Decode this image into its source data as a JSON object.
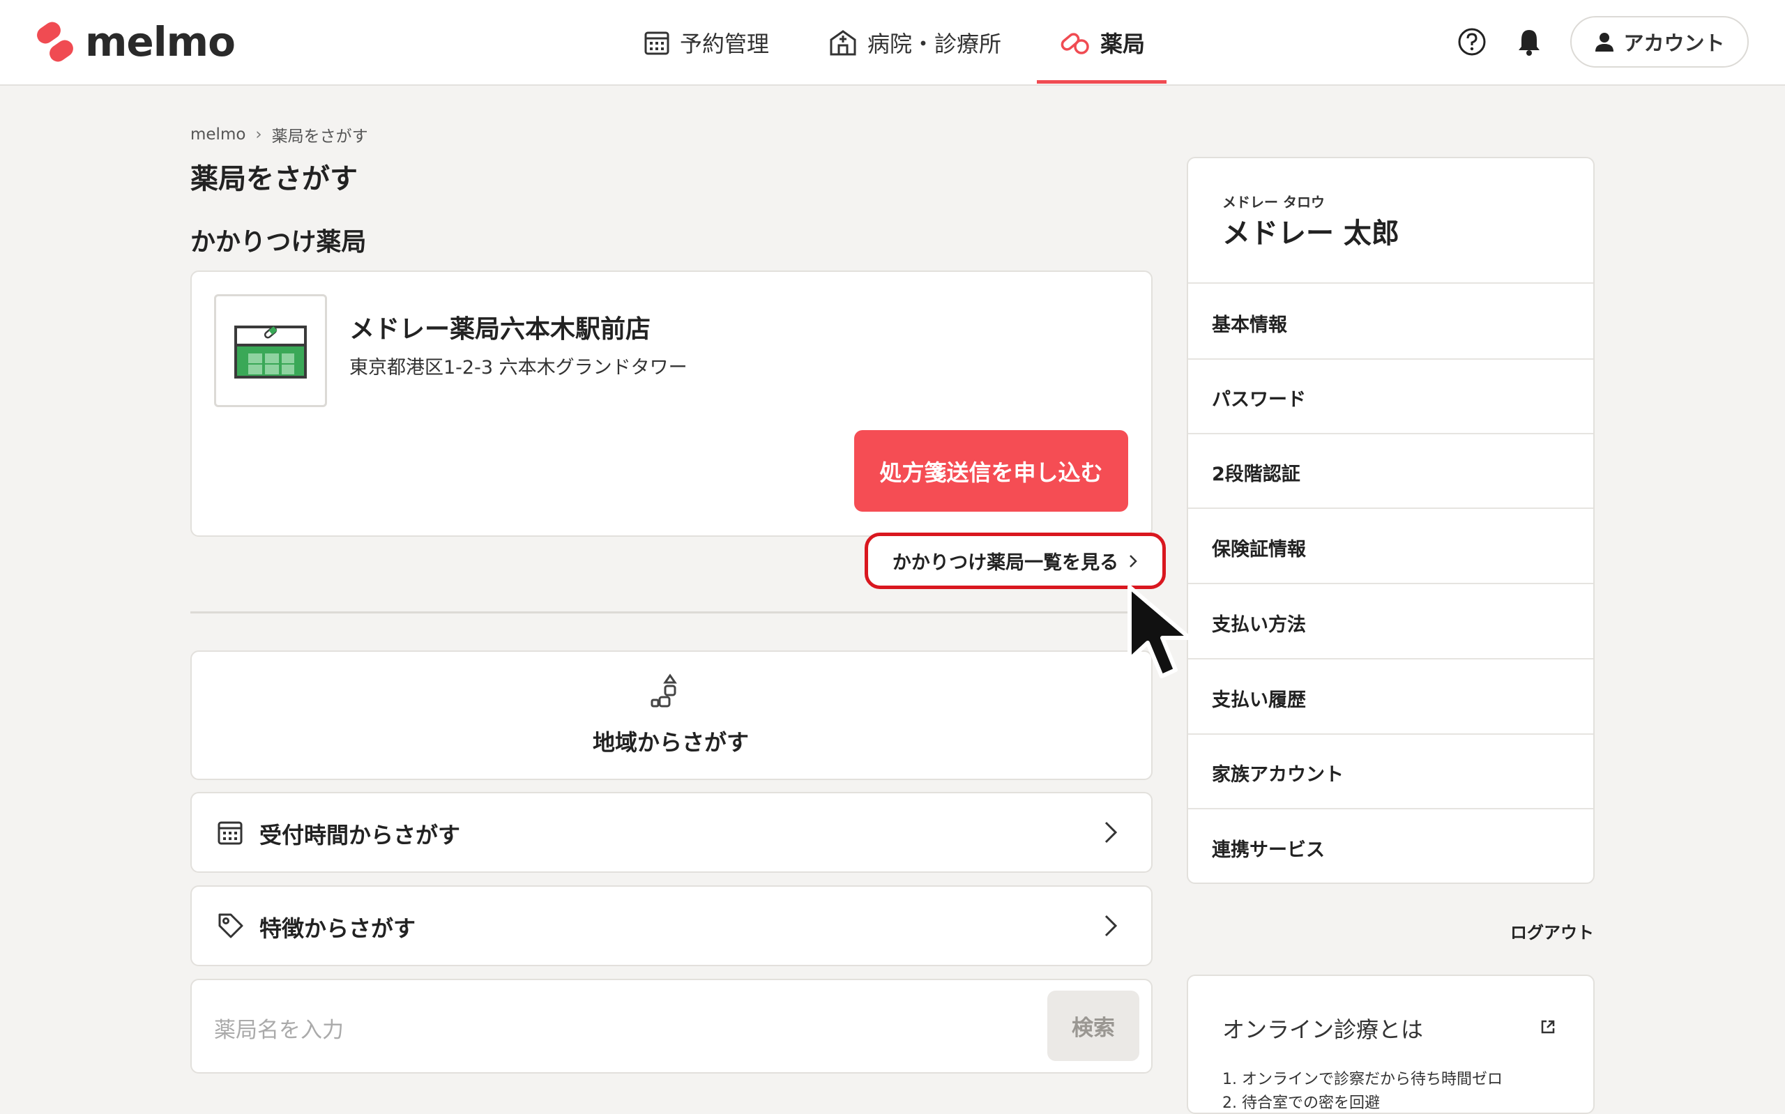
{
  "header": {
    "logo_text": "melmo",
    "nav": [
      {
        "label": "予約管理",
        "icon": "calendar-icon"
      },
      {
        "label": "病院・診療所",
        "icon": "hospital-icon"
      },
      {
        "label": "薬局",
        "icon": "pill-icon",
        "active": true
      }
    ],
    "help_icon": "help-icon",
    "bell_icon": "bell-icon",
    "account_label": "アカウント"
  },
  "breadcrumb": {
    "home": "melmo",
    "current": "薬局をさがす"
  },
  "page_title": "薬局をさがす",
  "favorite": {
    "section_title": "かかりつけ薬局",
    "pharmacy_name": "メドレー薬局六本木駅前店",
    "pharmacy_address": "東京都港区1-2-3 六本木グランドタワー",
    "apply_button": "処方箋送信を申し込む",
    "list_link": "かかりつけ薬局一覧を見る"
  },
  "search": {
    "region_label": "地域からさがす",
    "hours_label": "受付時間からさがす",
    "features_label": "特徴からさがす",
    "name_placeholder": "薬局名を入力",
    "search_button": "検索"
  },
  "profile": {
    "kana": "メドレー タロウ",
    "name": "メドレー 太郎",
    "menu": [
      "基本情報",
      "パスワード",
      "2段階認証",
      "保険証情報",
      "支払い方法",
      "支払い履歴",
      "家族アカウント",
      "連携サービス"
    ],
    "logout": "ログアウト"
  },
  "online": {
    "title": "オンライン診療とは",
    "items": [
      "1. オンラインで診察だから待ち時間ゼロ",
      "2. 待合室での密を回避"
    ]
  },
  "colors": {
    "accent": "#f54d54",
    "highlight": "#d9171f",
    "background": "#f4f3f1"
  }
}
